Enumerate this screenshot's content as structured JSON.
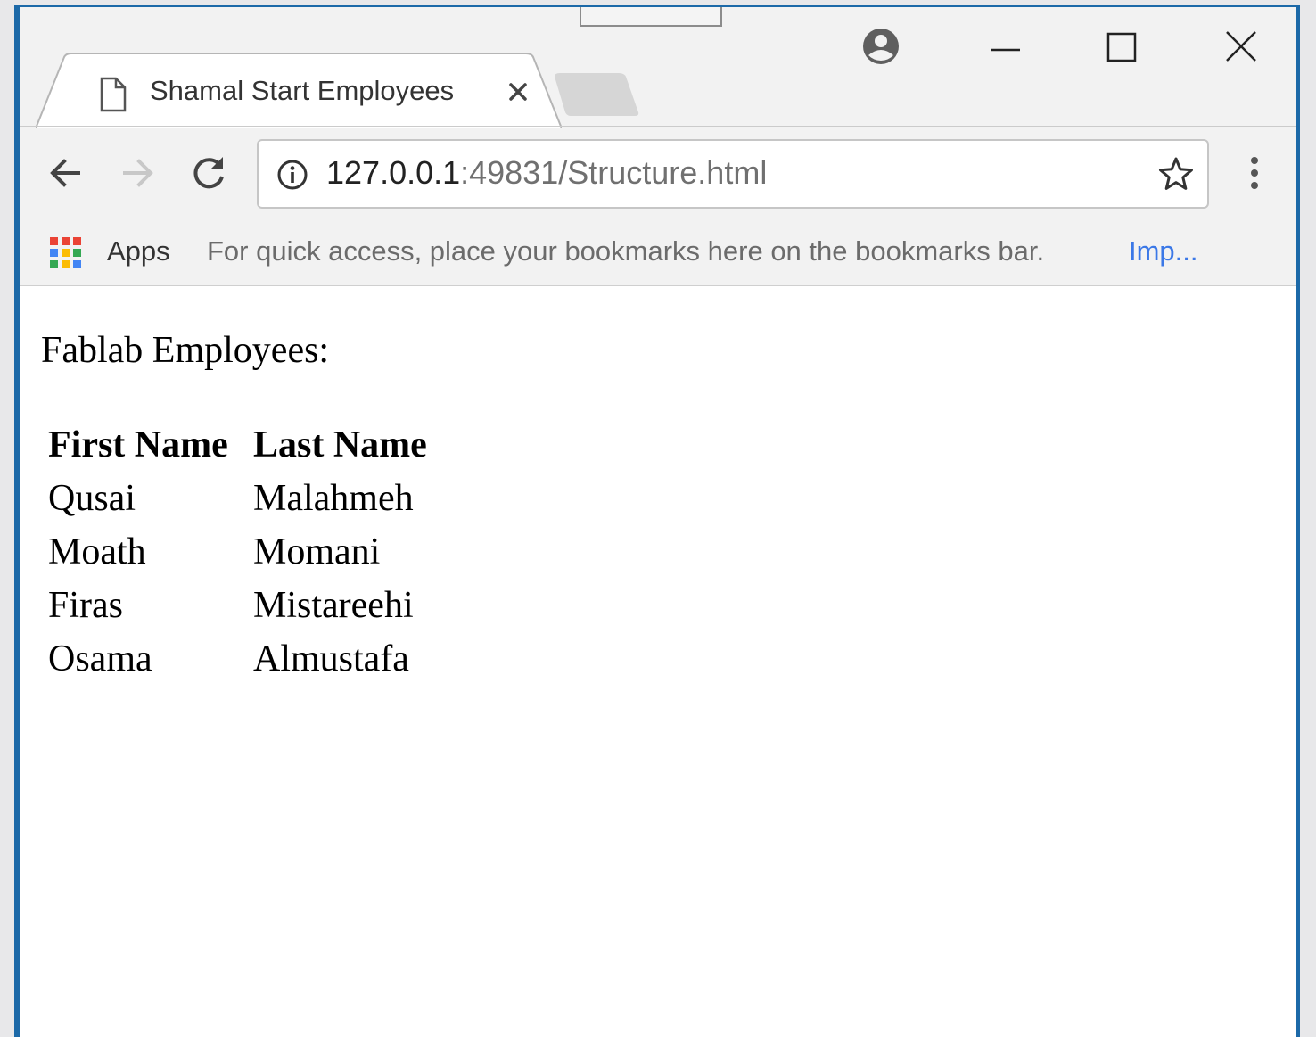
{
  "browser": {
    "tab": {
      "title": "Shamal Start Employees",
      "close_glyph": "×"
    },
    "address_bar": {
      "host": "127.0.0.1",
      "rest": ":49831/Structure.html"
    },
    "bookmarks_bar": {
      "apps_label": "Apps",
      "hint": "For quick access, place your bookmarks here on the bookmarks bar.",
      "import_link": "Imp..."
    },
    "icons": {
      "tab": "document-icon",
      "profile": "profile-icon",
      "minimize": "minimize-icon",
      "maximize": "maximize-icon",
      "close": "close-icon",
      "back": "back-arrow-icon",
      "forward": "forward-arrow-icon",
      "reload": "reload-icon",
      "info": "info-icon",
      "bookmark": "star-icon",
      "menu": "menu-dots-icon",
      "apps": "apps-grid-icon"
    }
  },
  "page": {
    "heading": "Fablab Employees:",
    "table": {
      "headers": [
        "First Name",
        "Last Name"
      ],
      "rows": [
        [
          "Qusai",
          "Malahmeh"
        ],
        [
          "Moath",
          "Momani"
        ],
        [
          "Firas",
          "Mistareehi"
        ],
        [
          "Osama",
          "Almustafa"
        ]
      ]
    }
  }
}
